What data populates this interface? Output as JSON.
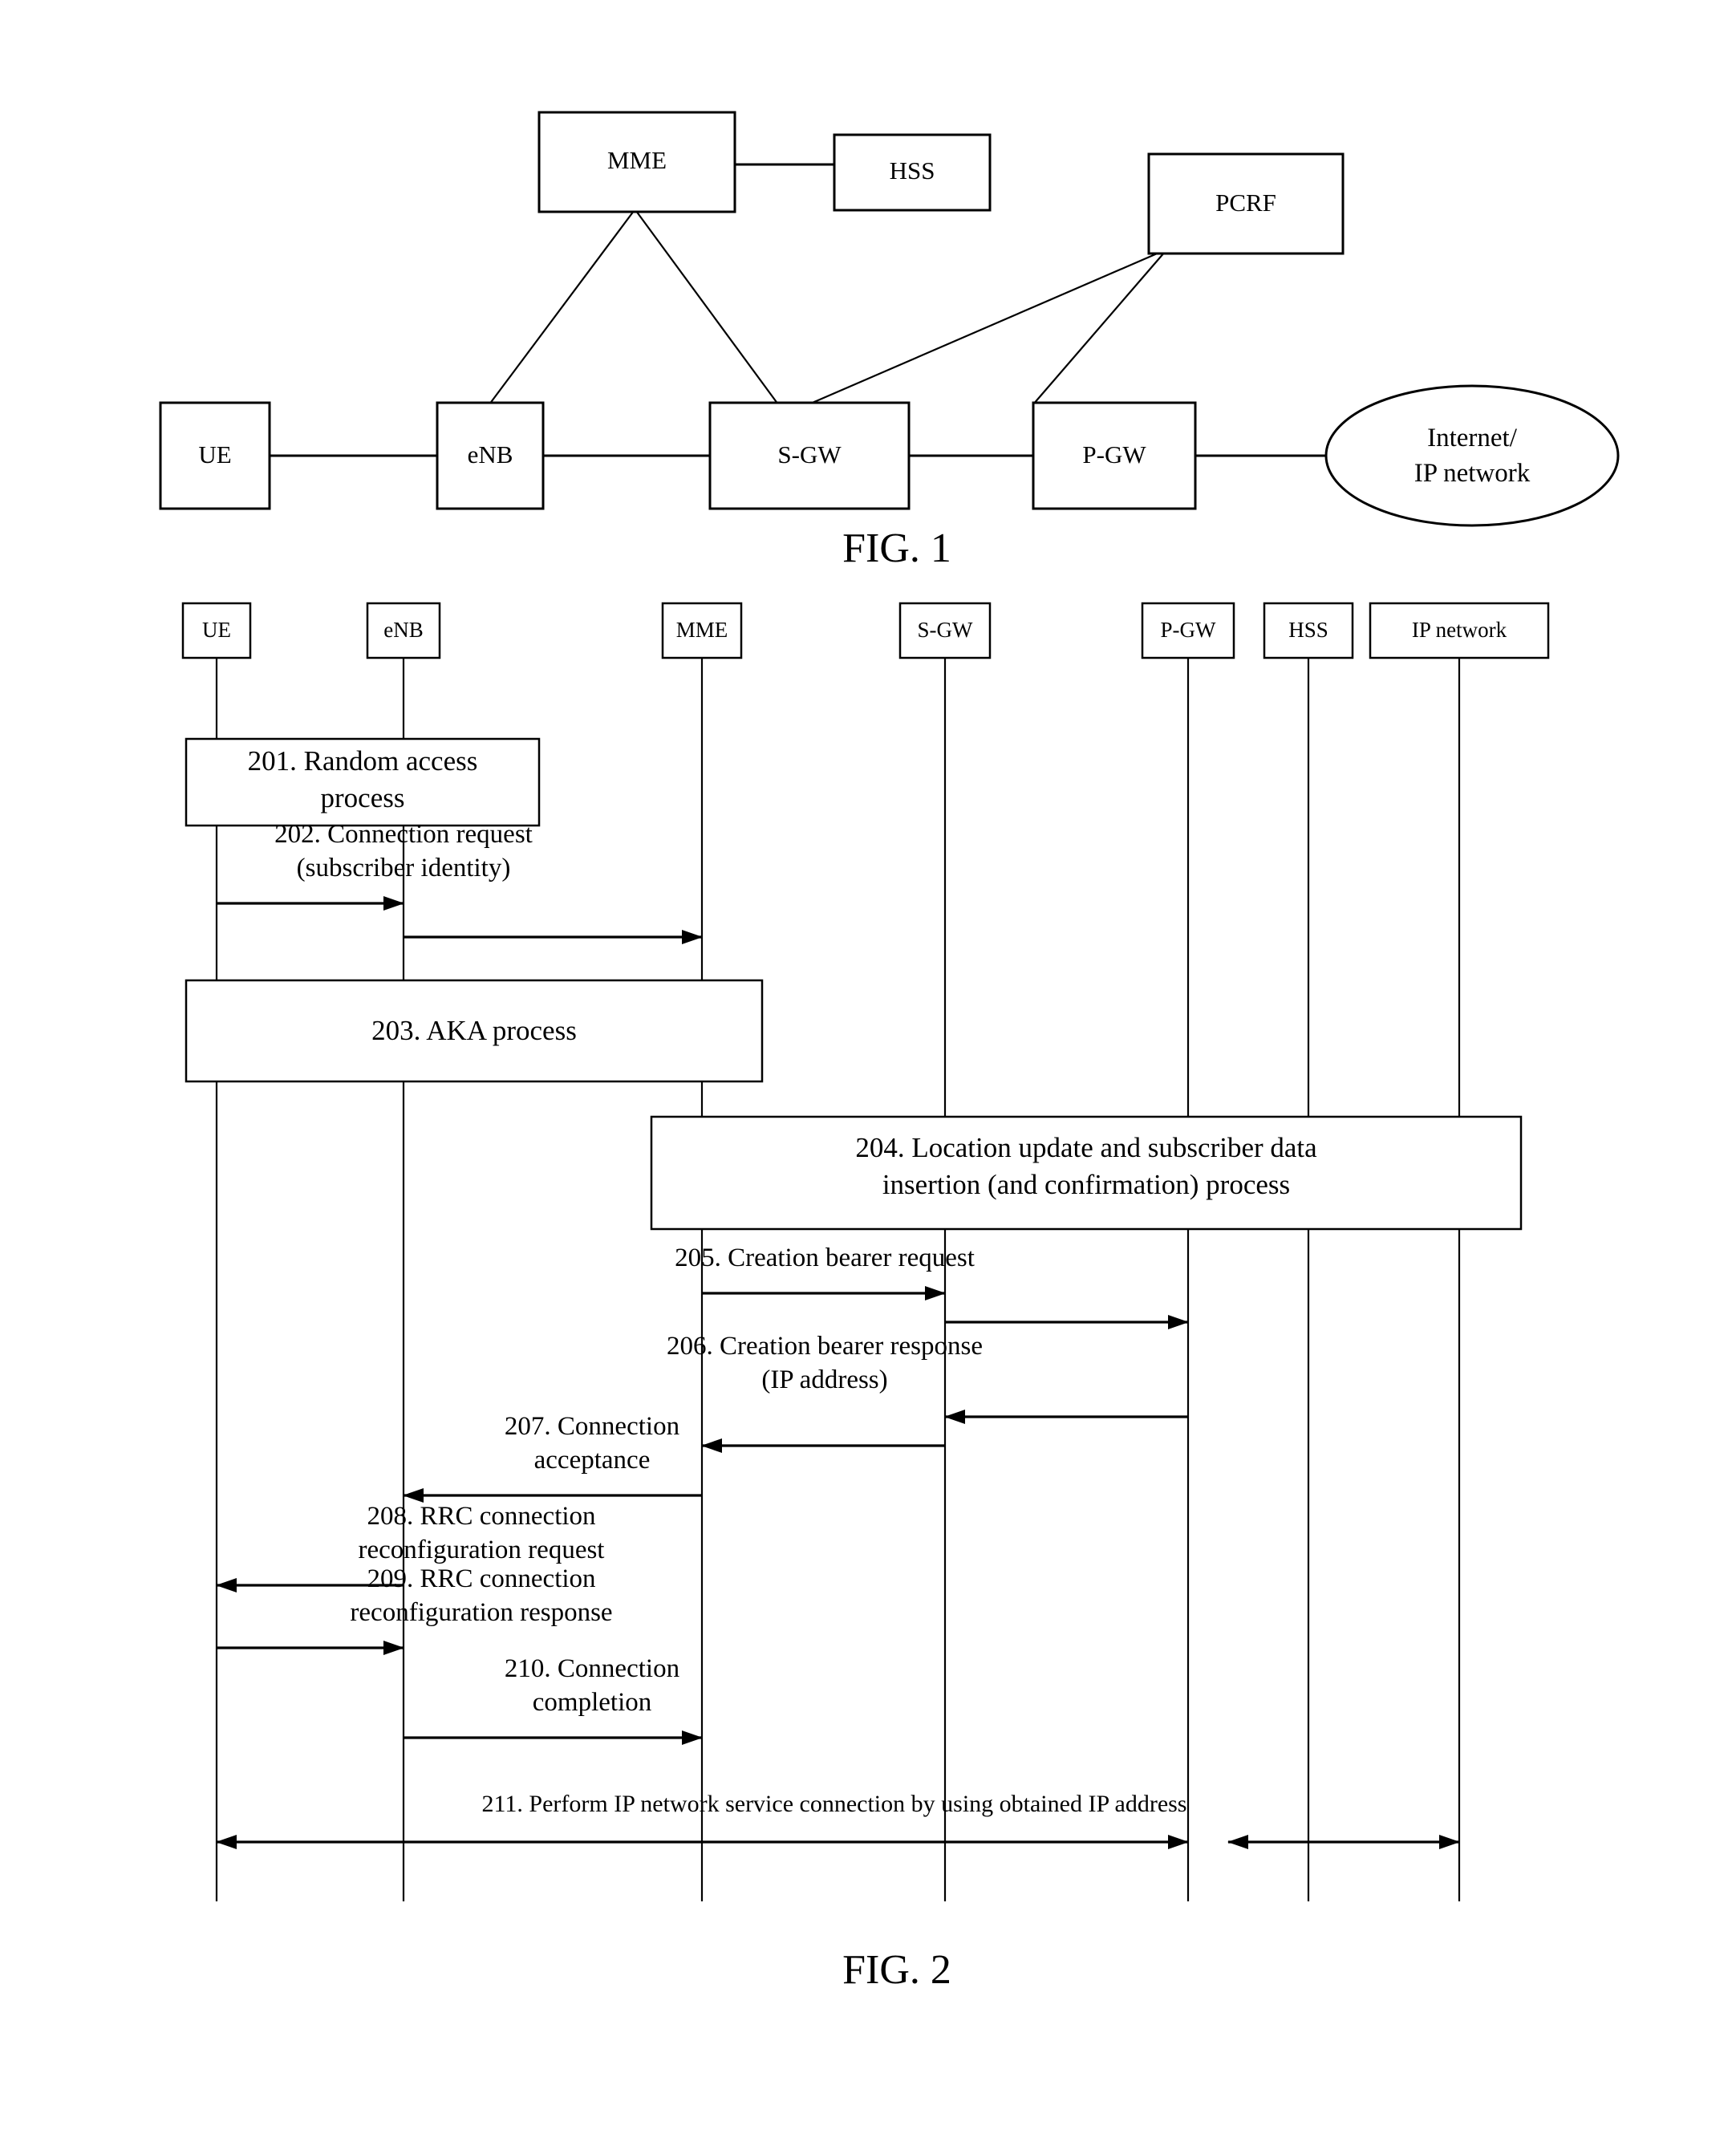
{
  "document": {
    "type": "patent-drawing-sheet",
    "figures": [
      {
        "caption": "FIG. 1",
        "kind": "network-architecture-diagram"
      },
      {
        "caption": "FIG. 2",
        "kind": "sequence-diagram"
      }
    ]
  },
  "fig1": {
    "caption": "FIG. 1",
    "nodes": {
      "mme": "MME",
      "hss": "HSS",
      "pcrf": "PCRF",
      "ue": "UE",
      "enb": "eNB",
      "sgw": "S-GW",
      "pgw": "P-GW",
      "internet_line1": "Internet/",
      "internet_line2": "IP network"
    },
    "links": [
      {
        "from": "MME",
        "to": "HSS"
      },
      {
        "from": "MME",
        "to": "eNB"
      },
      {
        "from": "MME",
        "to": "S-GW"
      },
      {
        "from": "PCRF",
        "to": "S-GW"
      },
      {
        "from": "PCRF",
        "to": "P-GW"
      },
      {
        "from": "UE",
        "to": "eNB"
      },
      {
        "from": "eNB",
        "to": "S-GW"
      },
      {
        "from": "S-GW",
        "to": "P-GW"
      },
      {
        "from": "P-GW",
        "to": "Internet/IP network"
      }
    ]
  },
  "fig2": {
    "caption": "FIG. 2",
    "lifelines": [
      {
        "id": "ue",
        "label": "UE"
      },
      {
        "id": "enb",
        "label": "eNB"
      },
      {
        "id": "mme",
        "label": "MME"
      },
      {
        "id": "sgw",
        "label": "S-GW"
      },
      {
        "id": "pgw",
        "label": "P-GW"
      },
      {
        "id": "hss",
        "label": "HSS"
      },
      {
        "id": "ipnet",
        "label": "IP network"
      }
    ],
    "steps": [
      {
        "number": "201",
        "kind": "process-box",
        "line1": "201. Random access",
        "line2": "process",
        "spans": [
          "ue",
          "enb"
        ]
      },
      {
        "number": "202",
        "kind": "message",
        "line1": "202. Connection request",
        "line2": "(subscriber identity)",
        "from": "ue",
        "to": "enb",
        "relay_to": "mme",
        "direction": "right"
      },
      {
        "number": "203",
        "kind": "process-box",
        "line1": "203. AKA process",
        "line2": "",
        "spans": [
          "ue",
          "mme"
        ]
      },
      {
        "number": "204",
        "kind": "process-box",
        "line1": "204. Location update and subscriber data",
        "line2": "insertion (and confirmation) process",
        "spans": [
          "mme",
          "ipnet"
        ]
      },
      {
        "number": "205",
        "kind": "message",
        "line1": "205. Creation bearer request",
        "line2": "",
        "from": "mme",
        "to": "sgw",
        "relay_to": "pgw",
        "direction": "right"
      },
      {
        "number": "206",
        "kind": "message",
        "line1": "206. Creation bearer response",
        "line2": "(IP address)",
        "from": "pgw",
        "to": "sgw",
        "relay_to": "mme",
        "direction": "left"
      },
      {
        "number": "207",
        "kind": "message",
        "line1": "207. Connection",
        "line2": "acceptance",
        "from": "mme",
        "to": "enb",
        "direction": "left"
      },
      {
        "number": "208",
        "kind": "message",
        "line1": "208. RRC connection",
        "line2": "reconfiguration request",
        "from": "enb",
        "to": "ue",
        "direction": "left"
      },
      {
        "number": "209",
        "kind": "message",
        "line1": "209. RRC connection",
        "line2": "reconfiguration response",
        "from": "ue",
        "to": "enb",
        "direction": "right"
      },
      {
        "number": "210",
        "kind": "message",
        "line1": "210. Connection",
        "line2": "completion",
        "from": "enb",
        "to": "mme",
        "direction": "right"
      },
      {
        "number": "211",
        "kind": "message",
        "line1": "211. Perform IP network service connection by using obtained IP address",
        "line2": "",
        "from": "ue",
        "to": "ipnet",
        "direction": "both"
      }
    ]
  },
  "colors": {
    "ink": "#000000",
    "paper": "#ffffff"
  }
}
